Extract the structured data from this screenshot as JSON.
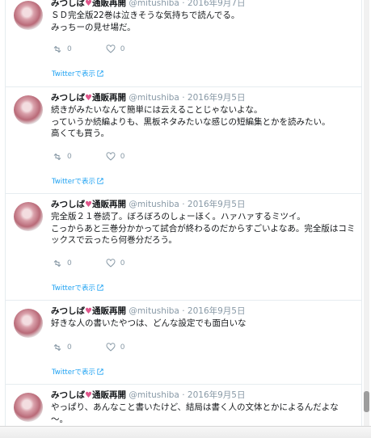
{
  "tweets": [
    {
      "name": "みつしば",
      "emoji": "♥",
      "name_suffix": "通販再開",
      "handle": "@mitushiba",
      "sep": "·",
      "date": "2016年9月7日",
      "lines": [
        "ＳＤ完全版22巻は泣きそうな気持ちで読んでる。",
        "みっちーの見せ場だ。"
      ],
      "retweets": "0",
      "likes": "0",
      "view_label": "Twitterで表示"
    },
    {
      "name": "みつしば",
      "emoji": "♥",
      "name_suffix": "通販再開",
      "handle": "@mitushiba",
      "sep": "·",
      "date": "2016年9月5日",
      "lines": [
        "続きがみたいなんて簡単には云えることじゃないよな。",
        "っていうか続編よりも、黒板ネタみたいな感じの短編集とかを読みたい。",
        "高くても買う。"
      ],
      "retweets": "0",
      "likes": "0",
      "view_label": "Twitterで表示"
    },
    {
      "name": "みつしば",
      "emoji": "♥",
      "name_suffix": "通販再開",
      "handle": "@mitushiba",
      "sep": "·",
      "date": "2016年9月5日",
      "lines": [
        "完全版２１巻読了。ぼろぼろのしょーほく。ハァハァするミツイ。",
        "こっからあと三巻分かかって試合が終わるのだからすごいよなあ。完全版はコミ",
        "ックスで云ったら何巻分だろう。"
      ],
      "retweets": "0",
      "likes": "0",
      "view_label": "Twitterで表示"
    },
    {
      "name": "みつしば",
      "emoji": "♥",
      "name_suffix": "通販再開",
      "handle": "@mitushiba",
      "sep": "·",
      "date": "2016年9月5日",
      "lines": [
        "好きな人の書いたやつは、どんな設定でも面白いな"
      ],
      "retweets": "0",
      "likes": "0",
      "view_label": "Twitterで表示"
    },
    {
      "name": "みつしば",
      "emoji": "♥",
      "name_suffix": "通販再開",
      "handle": "@mitushiba",
      "sep": "·",
      "date": "2016年9月5日",
      "lines": [
        "やっぱり、あんなこと書いたけど、結局は書く人の文体とかによるんだよな",
        "〜。"
      ],
      "retweets": "",
      "likes": "",
      "view_label": ""
    }
  ],
  "colors": {
    "accent": "#1da1f2",
    "muted": "#8899a6",
    "border": "#e6ecf0"
  },
  "icons": {
    "retweet": "retweet-icon",
    "like": "heart-icon",
    "external": "external-link-icon"
  }
}
